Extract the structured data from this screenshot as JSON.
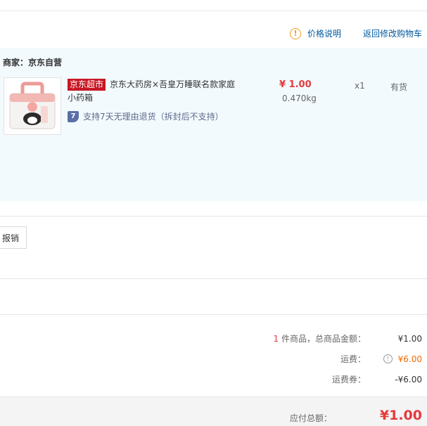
{
  "header": {
    "price_note_icon": "!",
    "price_note": "价格说明",
    "back_to_cart": "返回修改购物车"
  },
  "order": {
    "merchant_label": "商家：京东自营",
    "product": {
      "tag": "京东超市",
      "title": "京东大药房×吾皇万睡联名款家庭小药箱",
      "service_icon": "7",
      "service_text": "支持7天无理由退货（拆封后不支持）",
      "price": "¥ 1.00",
      "weight": "0.470kg",
      "quantity": "x1",
      "stock": "有货"
    }
  },
  "invoice": {
    "button_label": "报销"
  },
  "summary": {
    "count": "1",
    "count_label": " 件商品，总商品金额：",
    "goods_total": "¥1.00",
    "shipping_label": "运费：",
    "shipping_icon": "!",
    "shipping_value": "¥6.00",
    "coupon_label": "运费券：",
    "coupon_value": "-¥6.00",
    "payable_label": "应付总额：",
    "payable_value": "¥1.00"
  },
  "colors": {
    "accent_red": "#e4393c",
    "link_blue": "#005aa0",
    "tag_red": "#c81623",
    "panel_bg": "#f3fafe",
    "shipping_orange": "#f06a00"
  }
}
